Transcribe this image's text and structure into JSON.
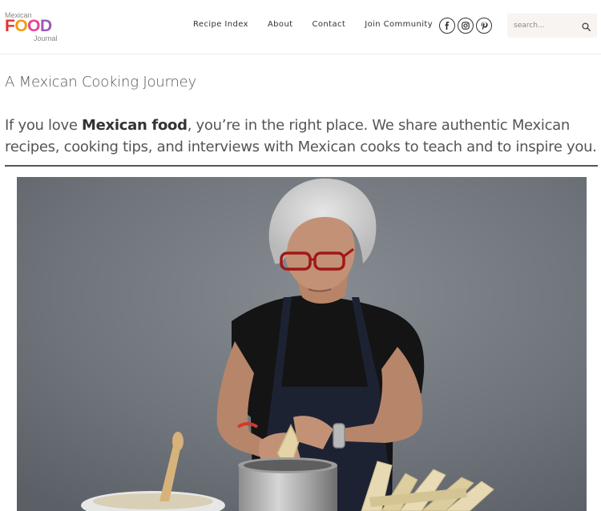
{
  "logo": {
    "top_text": "Mexican",
    "food_letters": [
      "F",
      "O",
      "O",
      "D"
    ],
    "food_colors": [
      "#e3342f",
      "#f39c12",
      "#e84393",
      "#9b59b6"
    ],
    "bottom_text": "Journal"
  },
  "nav": {
    "items": [
      {
        "label": "Recipe Index"
      },
      {
        "label": "About"
      },
      {
        "label": "Contact"
      },
      {
        "label": "Join Community"
      }
    ]
  },
  "social": {
    "icons": [
      "facebook-icon",
      "instagram-icon",
      "pinterest-icon"
    ]
  },
  "search": {
    "placeholder": "search...",
    "value": ""
  },
  "content": {
    "tagline": "A Mexican Cooking Journey",
    "intro_before": "If you love ",
    "intro_bold": "Mexican food",
    "intro_after": ", you’re in the right place. We share authentic Mexican recipes, cooking tips, and interviews with Mexican cooks to teach and to inspire you."
  },
  "colors": {
    "text": "#555555",
    "divider": "#555555",
    "search_bg": "#f7f4f2",
    "photo_bg": "#6e737a"
  }
}
